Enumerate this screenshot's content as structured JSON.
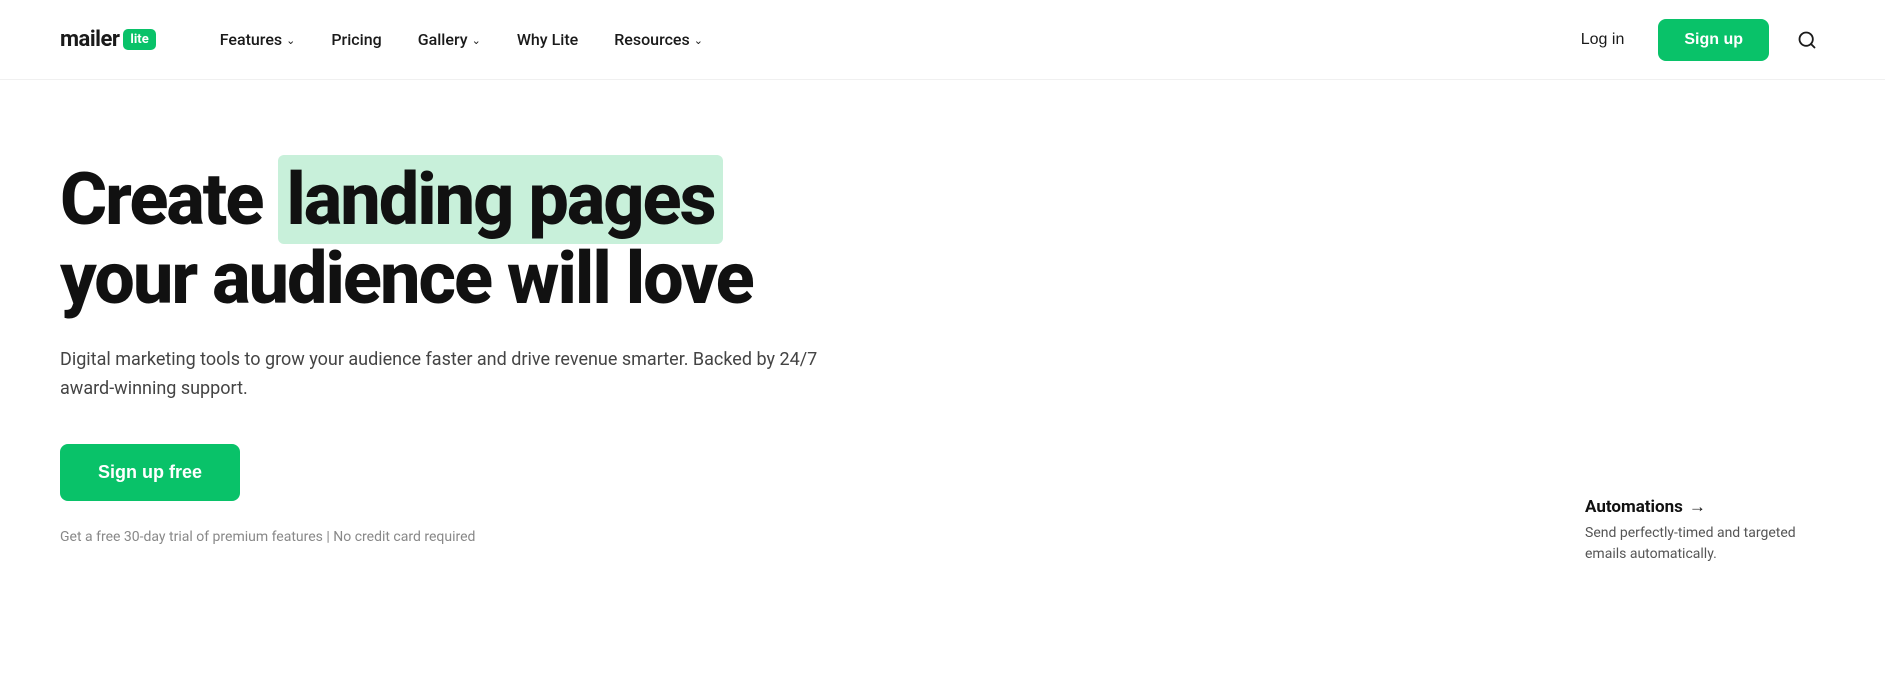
{
  "logo": {
    "text": "mailer",
    "badge": "lite"
  },
  "nav": {
    "links": [
      {
        "label": "Features",
        "hasDropdown": true
      },
      {
        "label": "Pricing",
        "hasDropdown": false
      },
      {
        "label": "Gallery",
        "hasDropdown": true
      },
      {
        "label": "Why Lite",
        "hasDropdown": false
      },
      {
        "label": "Resources",
        "hasDropdown": true
      }
    ],
    "login_label": "Log in",
    "signup_label": "Sign up"
  },
  "hero": {
    "title_prefix": "Create",
    "title_highlight": "landing pages",
    "title_suffix": "your audience will love",
    "subtitle": "Digital marketing tools to grow your audience faster and drive revenue smarter. Backed by 24/7 award-winning support.",
    "cta_label": "Sign up free",
    "footnote": "Get a free 30-day trial of premium features | No credit card required"
  },
  "automations": {
    "title": "Automations",
    "arrow": "→",
    "description": "Send perfectly-timed and targeted emails automatically."
  }
}
